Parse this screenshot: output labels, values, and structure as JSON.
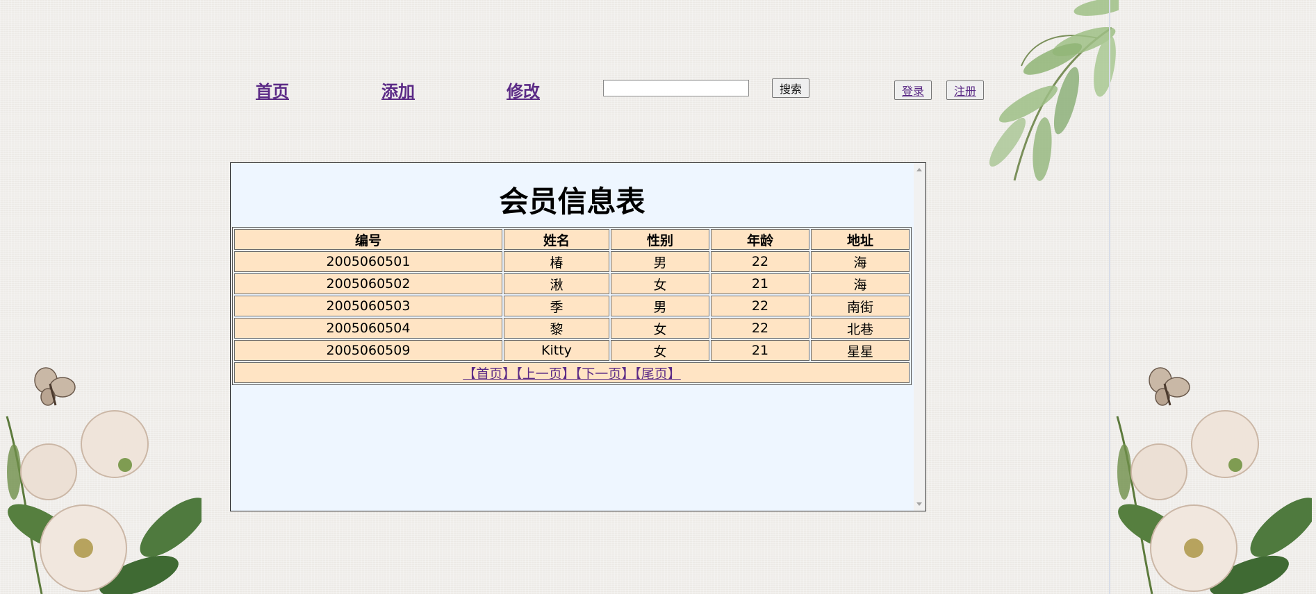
{
  "nav": {
    "home": "首页",
    "add": "添加",
    "edit": "修改"
  },
  "search": {
    "value": "",
    "placeholder": "",
    "button": "搜索"
  },
  "auth": {
    "login": "登录",
    "register": "注册"
  },
  "table": {
    "title": "会员信息表",
    "headers": [
      "编号",
      "姓名",
      "性别",
      "年龄",
      "地址"
    ],
    "rows": [
      [
        "2005060501",
        "椿",
        "男",
        "22",
        "海"
      ],
      [
        "2005060502",
        "湫",
        "女",
        "21",
        "海"
      ],
      [
        "2005060503",
        "季",
        "男",
        "22",
        "南街"
      ],
      [
        "2005060504",
        "黎",
        "女",
        "22",
        "北巷"
      ],
      [
        "2005060509",
        "Kitty",
        "女",
        "21",
        "星星"
      ]
    ],
    "pagination": {
      "first": "【首页】",
      "prev": "【上一页】",
      "next": "【下一页】",
      "last": "【尾页】"
    }
  },
  "colors": {
    "page_background": "#f1efec",
    "frame_background": "#eef6ff",
    "cell_background": "#ffe4c4",
    "link": "#5b2a86"
  },
  "icons": [
    "leaf-branch-decoration",
    "butterfly-icon",
    "magnolia-flower-decoration",
    "scroll-up-icon",
    "scroll-down-icon"
  ]
}
